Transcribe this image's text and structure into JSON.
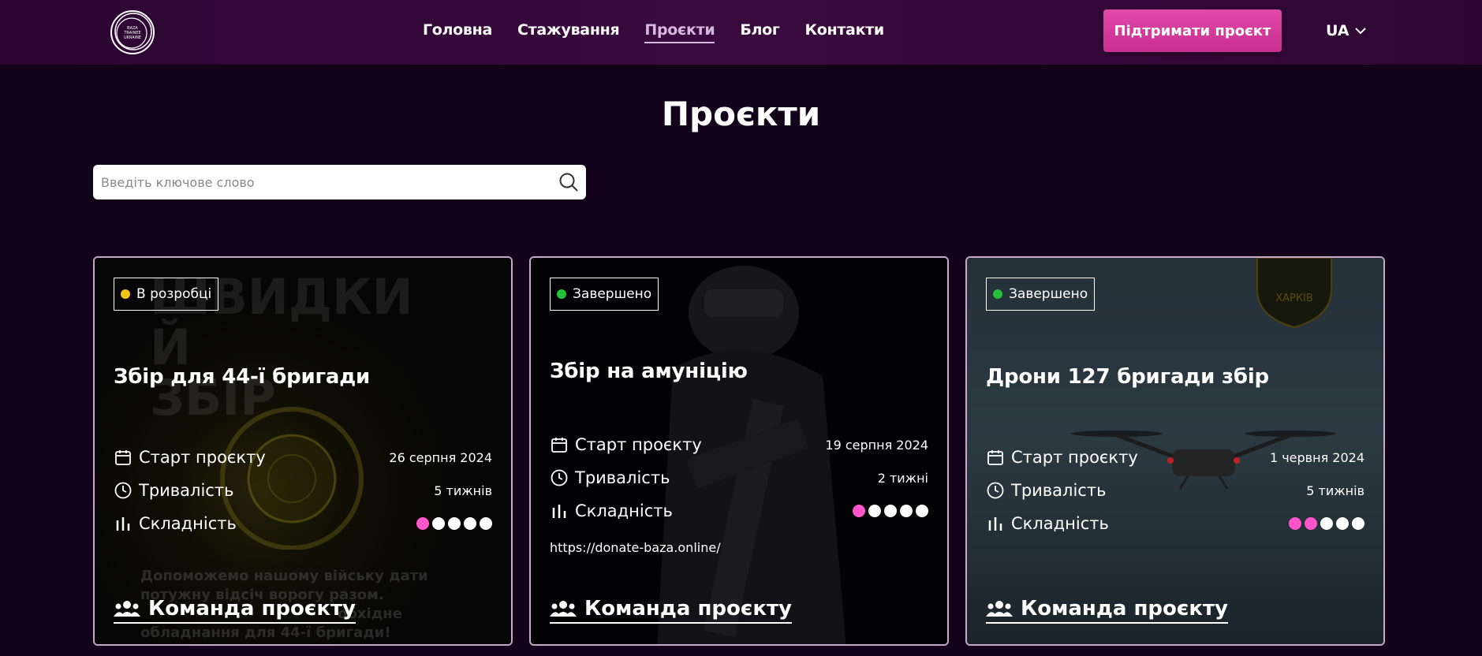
{
  "header": {
    "logo_text": [
      "BAZA",
      "TRAINEE",
      "UKRAINE"
    ],
    "nav": [
      {
        "label": "Головна",
        "active": false
      },
      {
        "label": "Стажування",
        "active": false
      },
      {
        "label": "Проєкти",
        "active": true
      },
      {
        "label": "Блог",
        "active": false
      },
      {
        "label": "Контакти",
        "active": false
      }
    ],
    "support_label": "Підтримати проєкт",
    "lang": "UA"
  },
  "page_title": "Проєкти",
  "search": {
    "placeholder": "Введіть ключове слово"
  },
  "labels": {
    "start": "Старт проєкту",
    "duration": "Тривалість",
    "difficulty": "Складність",
    "team": "Команда проєкту"
  },
  "colors": {
    "status_in_progress": "#f5c518",
    "status_done": "#22c33a",
    "accent_pink": "#e04aa8",
    "difficulty_on": "#ff55c8"
  },
  "cards": [
    {
      "status": "В розробці",
      "status_color": "#f5c518",
      "title": "Збір для 44-ї бригади",
      "start_date": "26 серпня 2024",
      "duration": "5 тижнів",
      "difficulty": 1,
      "bg_lines": [
        "ШВИДКИ",
        "Й",
        "ЗБІР"
      ],
      "bg_text": [
        "Допоможемо нашому війську дати",
        "потужну відсіч ворогу разом.",
        "обхідне",
        "обладнання для 44-ї бригади!"
      ]
    },
    {
      "status": "Завершено",
      "status_color": "#22c33a",
      "title": "Збір на амуніцію",
      "start_date": "19 серпня 2024",
      "duration": "2 тижні",
      "difficulty": 1,
      "link": "https://donate-baza.online/"
    },
    {
      "status": "Завершено",
      "status_color": "#22c33a",
      "title": "Дрони 127 бригади збір",
      "start_date": "1 червня 2024",
      "duration": "5 тижнів",
      "difficulty": 2,
      "emblem_text": "ХАРКІВ"
    }
  ]
}
